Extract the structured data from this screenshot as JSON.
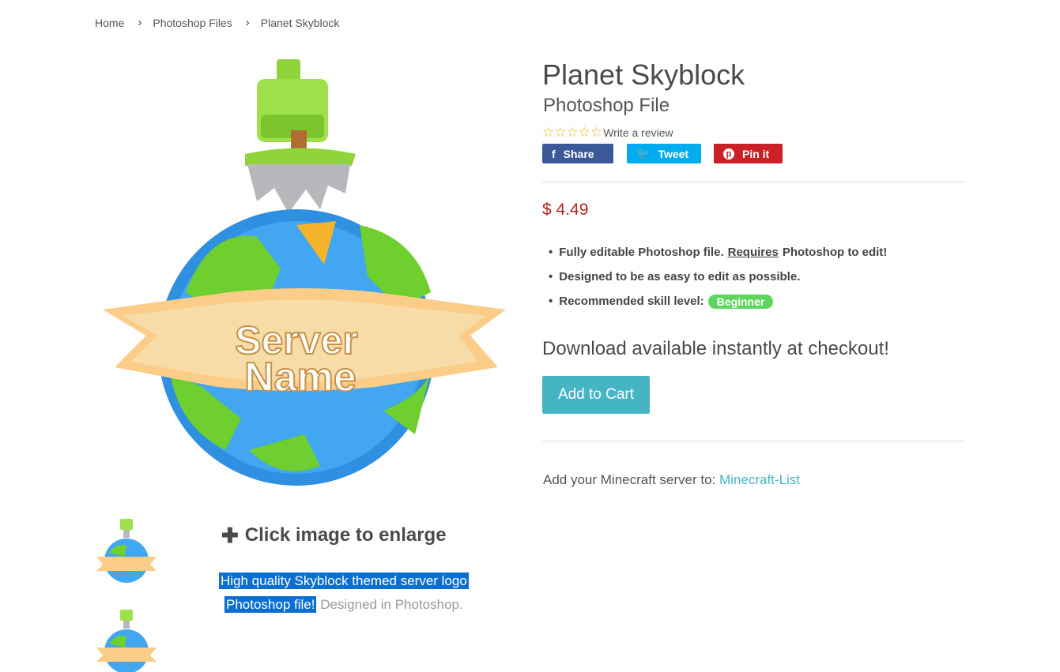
{
  "breadcrumb": {
    "home": "Home",
    "category": "Photoshop Files",
    "current": "Planet Skyblock",
    "separator": "›"
  },
  "product": {
    "title": "Planet Skyblock",
    "subtitle": "Photoshop File",
    "review_link": "Write a review",
    "stars_glyph": "☆☆☆☆☆",
    "rating": 0,
    "price": "$ 4.49",
    "features": {
      "f1_pre": "Fully editable Photoshop file.",
      "f1_req": "Requires",
      "f1_post": "Photoshop to edit!",
      "f2": "Designed to be as easy to edit as possible.",
      "f3_label": "Recommended skill level:",
      "f3_badge": "Beginner"
    },
    "download_text": "Download available instantly at checkout!",
    "add_to_cart": "Add to Cart",
    "server_prefix": "Add your Minecraft server to:",
    "server_link": "Minecraft-List"
  },
  "social": {
    "share": "Share",
    "tweet": "Tweet",
    "pin": "Pin it"
  },
  "gallery": {
    "enlarge_plus": "✚",
    "enlarge_text": "Click image to enlarge",
    "logo_line1": "Server",
    "logo_line2": "Name"
  },
  "description": {
    "highlight1": "High quality Skyblock themed server logo",
    "highlight2": "Photoshop file!",
    "rest": "Designed in Photoshop."
  },
  "colors": {
    "price": "#b3261e",
    "accent": "#45b5c4",
    "facebook": "#3b5998",
    "twitter": "#00aced",
    "pinterest": "#cb2027",
    "badge": "#5cd65c",
    "selection": "#0a6fd0"
  }
}
